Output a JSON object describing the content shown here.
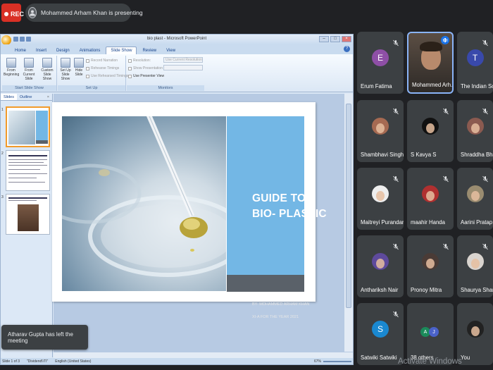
{
  "meet": {
    "rec_label": "REC",
    "presenter_initial": "",
    "presenting_text": "Mohammed Arham Khan is presenting",
    "toast": "Atharav Gupta has left the meeting",
    "watermark": "Activate Windows"
  },
  "powerpoint": {
    "window_title": "bio plast  -  Microsoft PowerPoint",
    "tabs": [
      "Home",
      "Insert",
      "Design",
      "Animations",
      "Slide Show",
      "Review",
      "View"
    ],
    "active_tab": "Slide Show",
    "groups": {
      "start_slide_show": {
        "label": "Start Slide Show",
        "buttons": [
          "From Beginning",
          "From Current Slide",
          "Custom Slide Show"
        ]
      },
      "set_up": {
        "label": "Set Up",
        "buttons": [
          "Set Up Slide Show",
          "Hide Slide"
        ],
        "options": [
          "Record Narration",
          "Rehearse Timings",
          "Use Rehearsed Timings"
        ]
      },
      "monitors": {
        "label": "Monitors",
        "options": [
          "Resolution:",
          "Show Presentation On:",
          "Use Presenter View"
        ],
        "resolution_value": "Use Current Resolution"
      }
    },
    "panel_tabs": [
      "Slides",
      "Outline"
    ],
    "slide_numbers": [
      "1",
      "2",
      "3"
    ],
    "slide": {
      "title_line1": "GUIDE TO",
      "title_line2": "BIO- PLASTIC",
      "by_text": "BY-   MOHAMMED ARHAM KHAN",
      "class_text": "XI-A        FOR THE YEAR 2021"
    },
    "status": {
      "slide_of": "Slide 1 of 3",
      "theme": "\"Dividend\\\\TI\"",
      "language": "English (United States)",
      "zoom": "67%"
    }
  },
  "participants": [
    {
      "name": "Erum Fatima",
      "initial": "E",
      "color": "#8e4fa6",
      "kind": "letter"
    },
    {
      "name": "Mohammed Arh...",
      "initial": "",
      "color": "#6b5a4c",
      "kind": "video"
    },
    {
      "name": "The Indian School",
      "initial": "T",
      "color": "#3949ab",
      "kind": "letter"
    },
    {
      "name": "Shambhavi Singh",
      "initial": "",
      "color": "#a66a52",
      "kind": "photo"
    },
    {
      "name": "S Kavya S",
      "initial": "",
      "color": "#111111",
      "kind": "photo"
    },
    {
      "name": "Shraddha Bhatter",
      "initial": "",
      "color": "#8b5a50",
      "kind": "photo"
    },
    {
      "name": "Maitreyi Purandare",
      "initial": "",
      "color": "#eeeeee",
      "kind": "photo"
    },
    {
      "name": "maahir Handa",
      "initial": "",
      "color": "#b03030",
      "kind": "photo"
    },
    {
      "name": "Aarini Pratap",
      "initial": "",
      "color": "#9a8c70",
      "kind": "photo"
    },
    {
      "name": "Anthariksh Nair",
      "initial": "",
      "color": "#5e4a9c",
      "kind": "photo"
    },
    {
      "name": "Pronoy Mitra",
      "initial": "",
      "color": "#4a3b36",
      "kind": "photo"
    },
    {
      "name": "Shaurya Sharma",
      "initial": "",
      "color": "#d9d4cf",
      "kind": "photo"
    },
    {
      "name": "Satwiki Satwiki",
      "initial": "S",
      "color": "#1a88d0",
      "kind": "letter"
    },
    {
      "name": "38 others",
      "initial": "",
      "color": "",
      "kind": "others",
      "others": [
        "A",
        "J"
      ],
      "others_colors": [
        "#1b8a5a",
        "#4a62c9"
      ]
    },
    {
      "name": "You",
      "initial": "",
      "color": "#222222",
      "kind": "photo"
    }
  ]
}
